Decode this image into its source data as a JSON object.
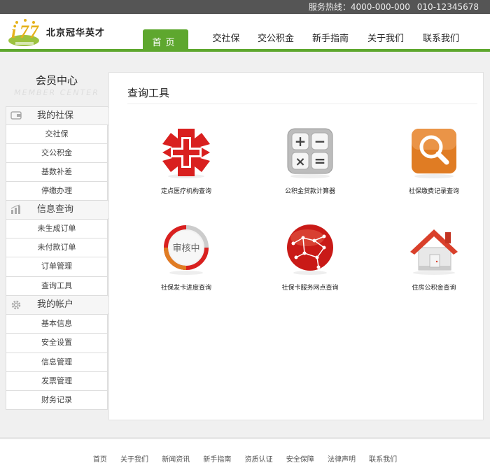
{
  "topbar": {
    "hotline_label": "服务热线：4000-000-000",
    "hotline_phone2": "010-12345678"
  },
  "brand": {
    "name": "北京冠华英才"
  },
  "nav": {
    "items": [
      {
        "label": "首页",
        "active": true
      },
      {
        "label": "交社保"
      },
      {
        "label": "交公积金"
      },
      {
        "label": "新手指南"
      },
      {
        "label": "关于我们"
      },
      {
        "label": "联系我们"
      }
    ]
  },
  "sidebar": {
    "title": "会员中心",
    "subtitle": "MEMBER CENTER",
    "categories": [
      {
        "label": "我的社保",
        "icon": "wallet-icon",
        "items": [
          "交社保",
          "交公积金",
          "基数补差",
          "停缴办理"
        ]
      },
      {
        "label": "信息查询",
        "icon": "bar-chart-icon",
        "items": [
          "未生成订单",
          "未付款订单",
          "订单管理",
          "查询工具"
        ]
      },
      {
        "label": "我的帐户",
        "icon": "gear-icon",
        "items": [
          "基本信息",
          "安全设置",
          "信息管理",
          "发票管理",
          "财务记录"
        ]
      }
    ]
  },
  "main": {
    "title": "查询工具",
    "tools": [
      {
        "label": "定点医疗机构查询",
        "icon": "medical-cross-icon"
      },
      {
        "label": "公积金贷款计算器",
        "icon": "calculator-icon"
      },
      {
        "label": "社保缴费记录查询",
        "icon": "magnifier-icon"
      },
      {
        "label": "社保发卡进度查询",
        "icon": "progress-ring-icon",
        "badge": "审核中"
      },
      {
        "label": "社保卡服务网点查询",
        "icon": "network-globe-icon"
      },
      {
        "label": "住房公积金查询",
        "icon": "house-icon"
      }
    ]
  },
  "footer": {
    "links": [
      "首页",
      "关于我们",
      "新闻资讯",
      "新手指南",
      "资质认证",
      "安全保障",
      "法律声明",
      "联系我们"
    ]
  },
  "colors": {
    "accent": "#5ea72e",
    "topbar": "#555555",
    "red": "#d9201f",
    "orange": "#e07c23"
  }
}
